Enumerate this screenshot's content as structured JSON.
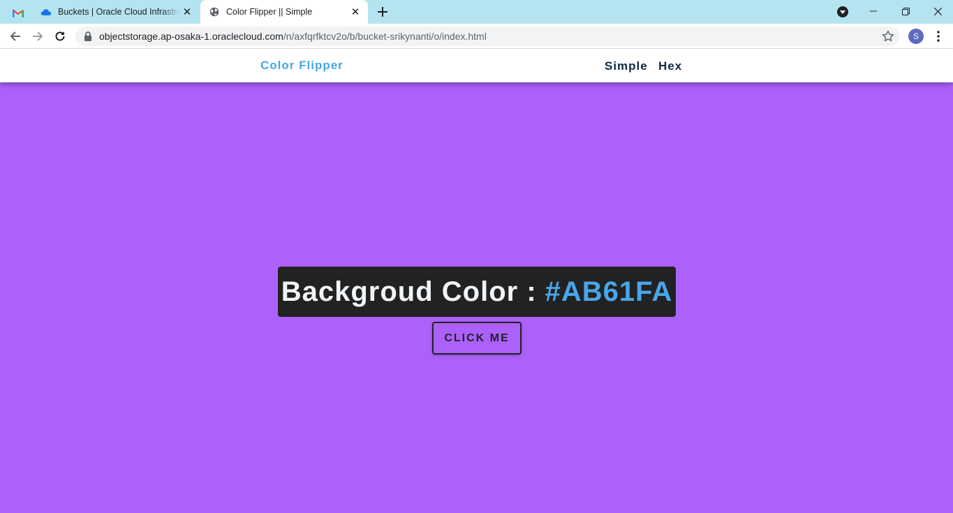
{
  "browser": {
    "tabs": [
      {
        "title": "Buckets | Oracle Cloud Infrastructure",
        "icon": "cloud-icon",
        "active": false
      },
      {
        "title": "Color Flipper || Simple",
        "icon": "globe-icon",
        "active": true
      }
    ],
    "pinned_tab_icon": "gmail-icon",
    "url": {
      "host": "objectstorage.ap-osaka-1.oraclecloud.com",
      "path": "/n/axfqrfktcv2o/b/bucket-srikynanti/o/index.html"
    },
    "profile_initial": "S",
    "colors": {
      "tabstrip": "#b4e4f0",
      "avatar": "#5c6bc0"
    }
  },
  "page": {
    "brand": "Color Flipper",
    "nav_links": [
      "Simple",
      "Hex"
    ],
    "color_label": "Backgroud Color :",
    "color_value": "#AB61FA",
    "button_label": "CLICK ME",
    "colors": {
      "background": "#ab61fa",
      "accent": "#49a6e9",
      "dark": "#222222",
      "nav_text": "#102a42"
    }
  }
}
